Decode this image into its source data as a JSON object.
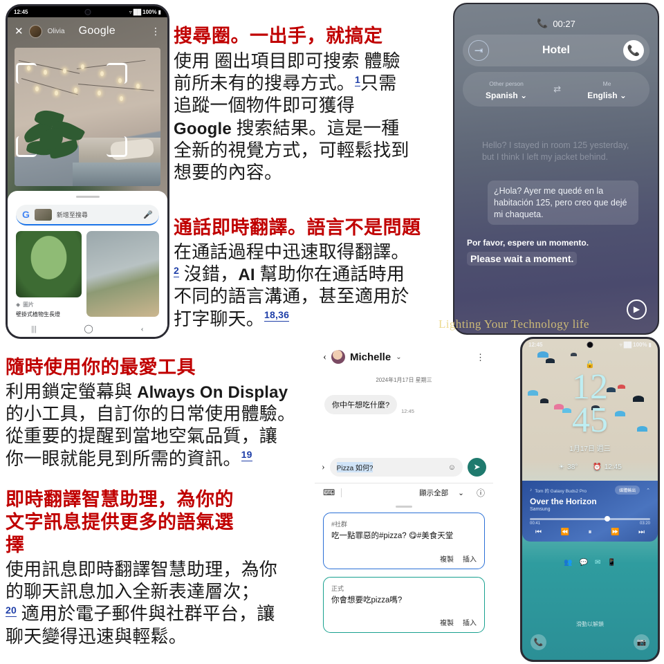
{
  "page": {
    "watermark": "Lighting Your Technology life"
  },
  "copy": {
    "block1": {
      "heading": "搜尋圈。一出手，就搞定",
      "line1_a": "使用 ",
      "line1_b": "圈出項目即可搜索",
      "line1_c": " 體驗",
      "line2_a": "前所未有的搜尋方式。",
      "line2_ref": "1",
      "line2_b": "只需",
      "line3": "追蹤一個物件即可獲得",
      "line4_a": "Google",
      "line4_b": " 搜索結果。這是一種",
      "line5": "全新的視覺方式，可輕鬆找到",
      "line6": "想要的內容。"
    },
    "block2": {
      "heading": "通話即時翻譯。語言不是問題",
      "line1": "在通話過程中迅速取得翻譯。",
      "line2_ref": "2",
      "line2_a": " 沒錯，",
      "line2_b": "AI",
      "line2_c": " 幫助你在通話時用",
      "line3": "不同的語言溝通，甚至適用於",
      "line4": "打字聊天。",
      "line4_ref": "18,36"
    },
    "block3": {
      "heading": "隨時使用你的最愛工具",
      "line1_a": "利用鎖定螢幕與 ",
      "line1_b": "Always On Display",
      "line2": "的小工具，自訂你的日常使用體驗。",
      "line3": "從重要的提醒到當地空氣品質，讓",
      "line4": "你一眼就能見到所需的資訊。",
      "line4_ref": "19"
    },
    "block4": {
      "heading_l1": "即時翻譯智慧助理，為你的",
      "heading_l2": "文字訊息提供更多的語氣選",
      "heading_l3": "擇",
      "line1": "使用訊息即時翻譯智慧助理，為你",
      "line2": "的聊天訊息加入全新表達層次；",
      "line3_ref": "20",
      "line3": " 適用於電子郵件與社群平台，讓",
      "line4": "聊天變得迅速與輕鬆。"
    }
  },
  "phone_circle_search": {
    "status": {
      "time": "12:45",
      "wifi": "wifi-icon",
      "signal": "signal-icon",
      "battery": "100%"
    },
    "appbar": {
      "close": "✕",
      "user": "Olivia",
      "title": "Google",
      "menu": "⋮"
    },
    "searchbar": {
      "logo": "G",
      "placeholder": "新增至搜尋",
      "mic": "mic-icon"
    },
    "results": [
      {
        "source": "圖片",
        "caption": "壁掛式植物生長燈"
      }
    ],
    "navbar": {
      "recents": "|||",
      "home": "◯",
      "back": "‹"
    }
  },
  "phone_live_translate": {
    "call": {
      "duration": "00:27",
      "phone_icon": "phone-icon"
    },
    "header": {
      "exit": "exit-icon",
      "title": "Hotel",
      "end_call": "end-call-icon"
    },
    "languages": {
      "other_label": "Other person",
      "other_value": "Spanish",
      "swap": "⇄",
      "me_label": "Me",
      "me_value": "English"
    },
    "transcript": {
      "ghost": "Hello? I stayed in room 125 yesterday, but I think I left my jacket behind.",
      "translated": "¿Hola? Ayer me quedé en la habitación 125, pero creo que dejé mi chaqueta.",
      "me_source": "Por favor, espere un momento.",
      "me_target": "Please wait a moment."
    },
    "play_button": "▶"
  },
  "phone_chat": {
    "header": {
      "back": "‹",
      "contact": "Michelle",
      "chevron": "⌄",
      "menu": "⋮"
    },
    "date_divider": "2024年1月17日 星期三",
    "message": {
      "text": "你中午想吃什麼?",
      "time": "12:45"
    },
    "composer": {
      "expand": "›",
      "value": "Pizza 如何?",
      "emoji": "☺",
      "send": "send-icon"
    },
    "toolbar": {
      "keyboard": "keyboard-icon",
      "show_all": "顯示全部",
      "chevron": "⌄",
      "info": "!"
    },
    "tone_suggestions": [
      {
        "label": "#社群",
        "text": "吃一點罪惡的#pizza? 😋#美食天堂",
        "copy": "複製",
        "insert": "插入",
        "border_color": "#2a6fd6"
      },
      {
        "label": "正式",
        "text": "你會想要吃pizza嗎?",
        "copy": "複製",
        "insert": "插入",
        "border_color": "#17a08f"
      }
    ]
  },
  "phone_lockscreen": {
    "status": {
      "time": "12:45",
      "battery": "100%"
    },
    "lock_icon": "lock-icon",
    "clock": {
      "hours": "12",
      "minutes": "45"
    },
    "date": "1月17日 週三",
    "widgets": [
      {
        "icon": "weather-icon",
        "value": "38°"
      },
      {
        "icon": "alarm-icon",
        "value": "12:45"
      }
    ],
    "media": {
      "device": "Tom 的 Galaxy Buds2 Pro",
      "output_button": "媒體輸出",
      "collapse": "⌃",
      "title": "Over the Horizon",
      "artist": "Samsung",
      "elapsed": "00:41",
      "duration": "03:20",
      "controls": [
        "prev-track",
        "rewind",
        "pause",
        "fast-forward",
        "next-track"
      ]
    },
    "shortcut_icons": [
      "contacts-icon",
      "messages-icon",
      "mail-icon",
      "phone-app-icon"
    ],
    "swipe_hint": "滑動以解鎖",
    "bottom_left": "phone-icon",
    "bottom_right": "camera-icon"
  },
  "colors": {
    "heading_red": "#c00000",
    "reference_blue": "#1f3fa8",
    "send_green": "#1f7a6e",
    "watermark_gold": "#e8d27a"
  }
}
